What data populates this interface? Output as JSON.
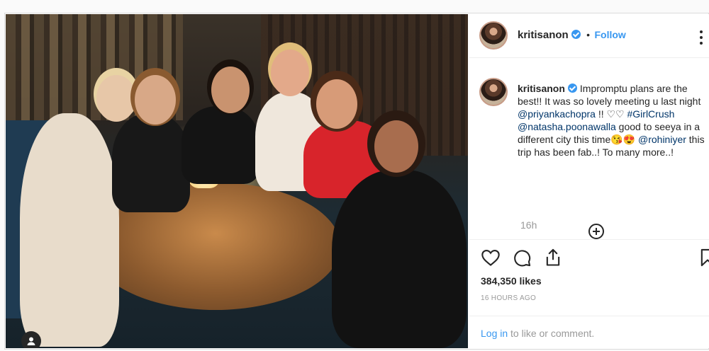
{
  "post": {
    "username": "kritisanon",
    "follow_label": "Follow",
    "separator": "•",
    "more_icon": "more-options-icon"
  },
  "caption": {
    "username": "kritisanon",
    "line1": "Impromptu plans are the best!! It was so lovely meeting u last night ",
    "mention1": "@priyankachopra",
    "line2": " !! ♡♡ ",
    "hashtag": "#GirlCrush",
    "mention2": "@natasha.poonawalla",
    "line3": " good to seeya in a different city this time😘😍 ",
    "mention3": "@rohiniyer",
    "line4": " this trip has been fab..! To many more..!"
  },
  "meta": {
    "time": "16h",
    "likes": "384,350 likes",
    "ago": "16 HOURS AGO"
  },
  "footer": {
    "login_link": "Log in",
    "login_rest": " to like or comment."
  },
  "icons": {
    "like": "heart-icon",
    "comment": "comment-icon",
    "share": "share-icon",
    "save": "bookmark-icon",
    "add": "add-comment-icon",
    "user_tag": "user-tag-icon"
  },
  "colors": {
    "link": "#3897f0",
    "verified": "#3897f0",
    "mention": "#003569"
  }
}
